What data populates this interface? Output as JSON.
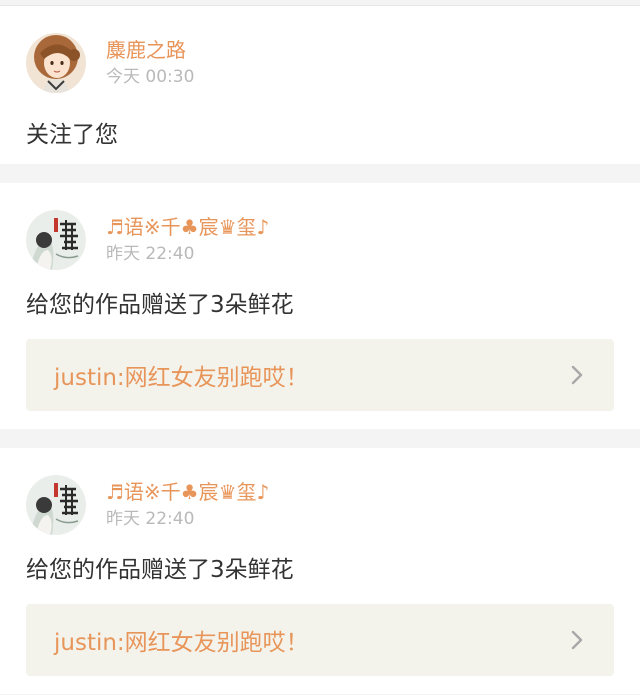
{
  "notifications": [
    {
      "username": "麋鹿之路",
      "time": "今天 00:30",
      "message": "关注了您",
      "avatar_icon": "anime-girl-avatar"
    },
    {
      "username": "♬语※千♣宸♛玺♪",
      "time": "昨天 22:40",
      "message": "给您的作品赠送了3朵鲜花",
      "avatar_icon": "book-cover-avatar",
      "quote": "justin:网红女友别跑哎！",
      "quote_icon": "chevron-right-icon"
    },
    {
      "username": "♬语※千♣宸♛玺♪",
      "time": "昨天 22:40",
      "message": "给您的作品赠送了3朵鲜花",
      "avatar_icon": "book-cover-avatar",
      "quote": "justin:网红女友别跑哎！",
      "quote_icon": "chevron-right-icon"
    }
  ],
  "colors": {
    "accent": "#e8955a",
    "timestamp": "#b9b9b9",
    "text": "#333333",
    "quote_bg": "#f3f3ec",
    "page_bg": "#f4f4f4"
  }
}
